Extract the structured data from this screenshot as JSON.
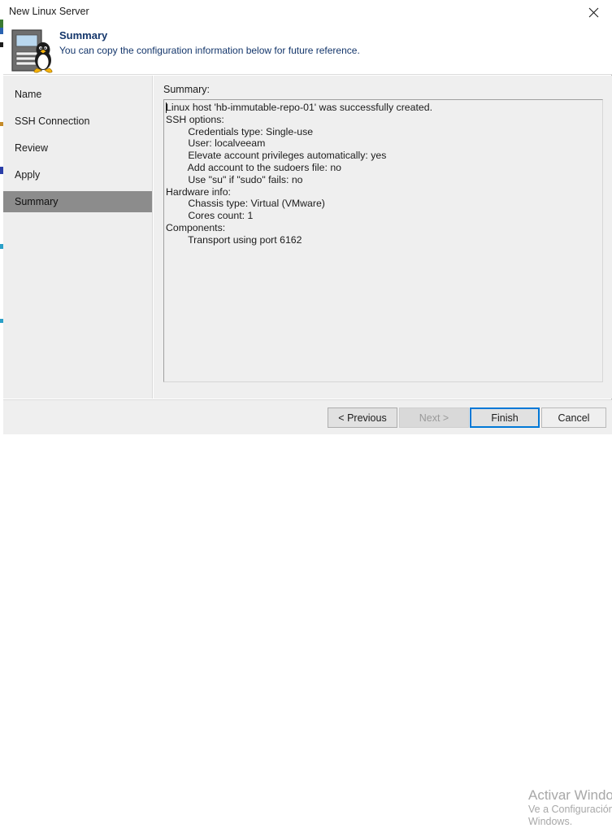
{
  "window": {
    "title": "New Linux Server",
    "close_icon": "close-icon"
  },
  "header": {
    "icon": "linux-server-icon",
    "title": "Summary",
    "subtitle": "You can copy the configuration information below for future reference."
  },
  "sidebar": {
    "items": [
      {
        "label": "Name",
        "selected": false
      },
      {
        "label": "SSH Connection",
        "selected": false
      },
      {
        "label": "Review",
        "selected": false
      },
      {
        "label": "Apply",
        "selected": false
      },
      {
        "label": "Summary",
        "selected": true
      }
    ]
  },
  "main": {
    "summary_label": "Summary:",
    "summary_text": "Linux host 'hb-immutable-repo-01' was successfully created.\nSSH options:\n        Credentials type: Single-use\n        User: localveeam\n        Elevate account privileges automatically: yes\n        Add account to the sudoers file: no\n        Use \"su\" if \"sudo\" fails: no\nHardware info:\n        Chassis type: Virtual (VMware)\n        Cores count: 1\nComponents:\n        Transport using port 6162"
  },
  "footer": {
    "previous_label": "< Previous",
    "next_label": "Next >",
    "finish_label": "Finish",
    "cancel_label": "Cancel"
  },
  "watermark": {
    "line1": "Activar Windows",
    "line2": "Ve a Configuración",
    "line3": "Windows."
  },
  "colors": {
    "accent": "#0078d7",
    "header_text": "#14366b",
    "selected_step_bg": "#8c8c8c",
    "panel_bg": "#efefef",
    "sidebar_bg": "#eeeeee"
  }
}
